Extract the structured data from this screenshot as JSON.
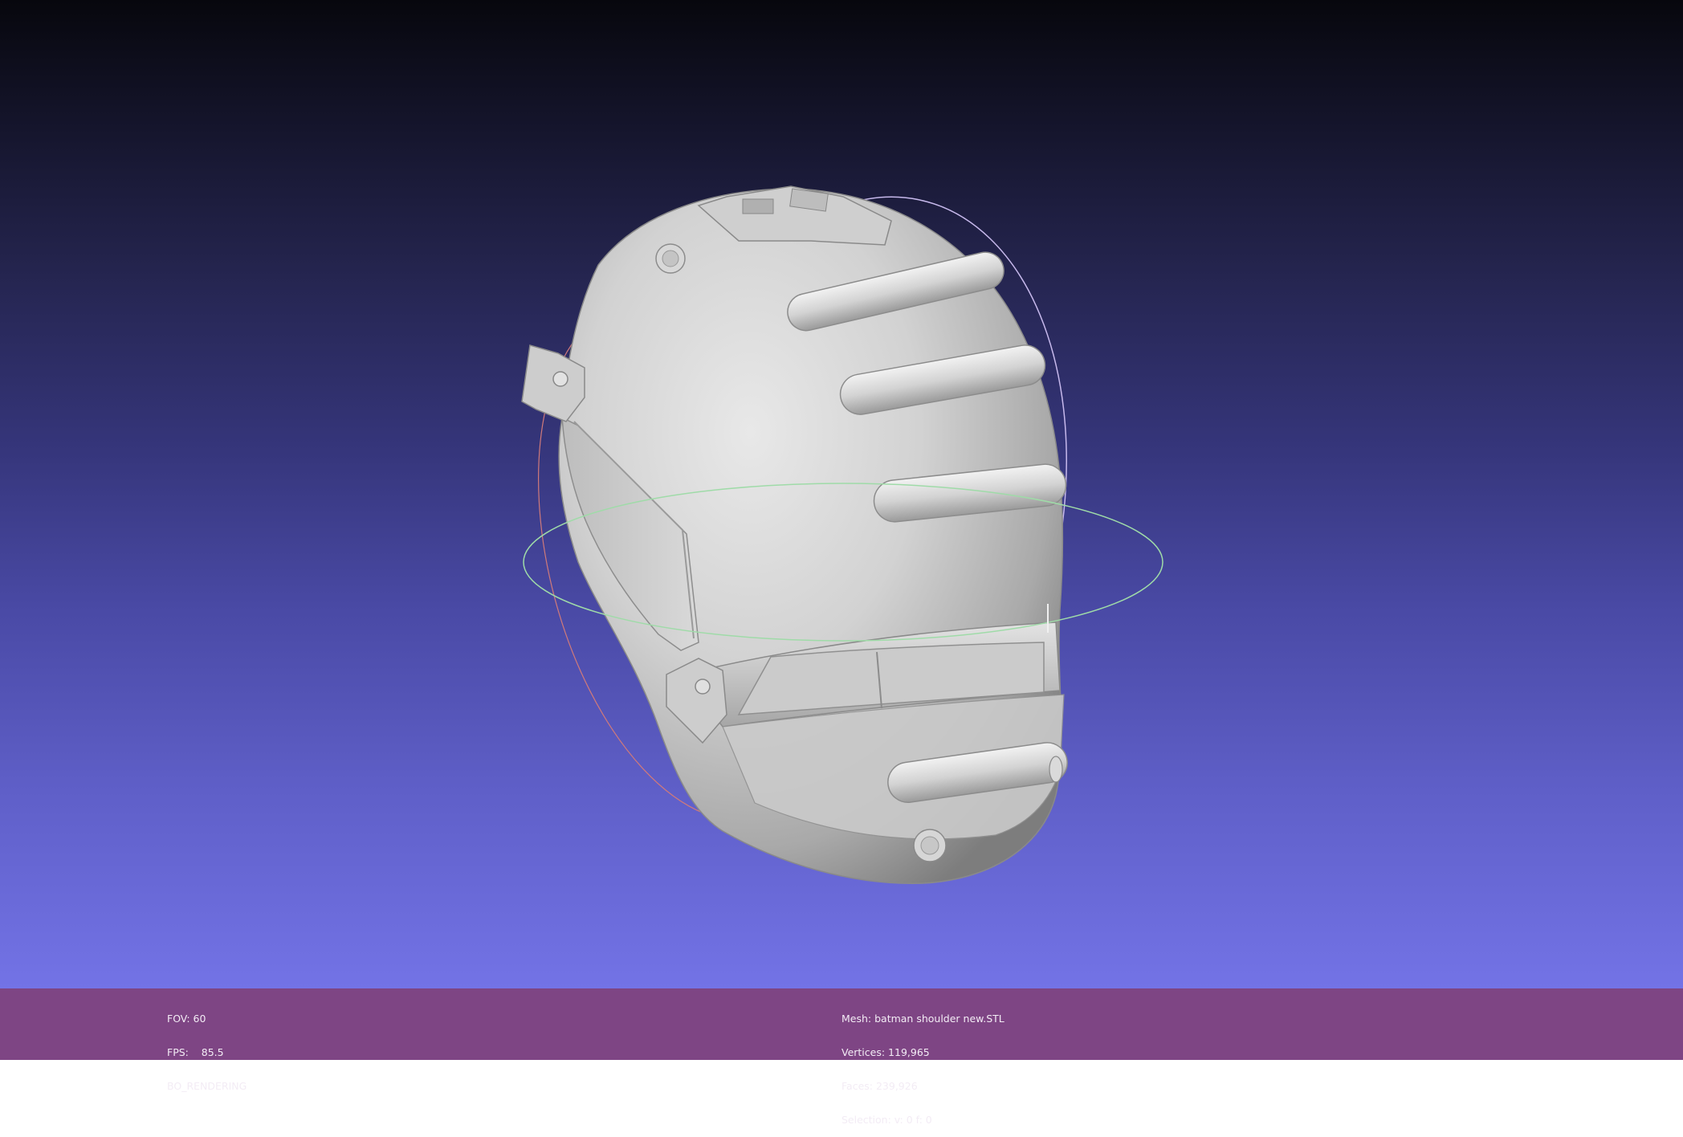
{
  "viewer": {
    "status_left": {
      "fov": "FOV: 60",
      "fps": "FPS:    85.5",
      "mode": "BO_RENDERING"
    },
    "status_right": {
      "mesh": "Mesh: batman shoulder new.STL",
      "vertices": "Vertices: 119,965",
      "faces": "Faces: 239,926",
      "selection": "Selection: v: 0 f: 0"
    }
  },
  "colors": {
    "background_top": "#07070d",
    "background_bottom": "#7373e6",
    "status_bar": "#7e4584",
    "mesh_surface": "#c8c8c8",
    "trackball_horizontal": "#8fd19a",
    "trackball_vertical": "#b8a8e0",
    "trackball_red": "#d07a7a"
  }
}
